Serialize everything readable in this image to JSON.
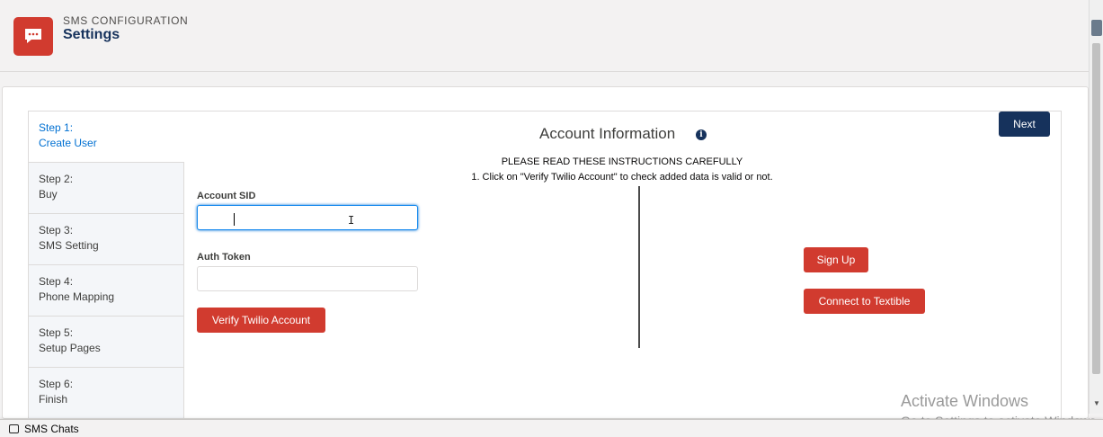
{
  "header": {
    "subtitle": "SMS CONFIGURATION",
    "title": "Settings",
    "icon": "chat-bubble-icon",
    "icon_color": "#d13b2f"
  },
  "steps": [
    {
      "step": "Step 1:",
      "label": "Create User",
      "active": true
    },
    {
      "step": "Step 2:",
      "label": "Buy",
      "active": false
    },
    {
      "step": "Step 3:",
      "label": "SMS Setting",
      "active": false
    },
    {
      "step": "Step 4:",
      "label": "Phone Mapping",
      "active": false
    },
    {
      "step": "Step 5:",
      "label": "Setup Pages",
      "active": false
    },
    {
      "step": "Step 6:",
      "label": "Finish",
      "active": false
    }
  ],
  "content": {
    "title": "Account Information",
    "instructions_heading": "PLEASE READ THESE INSTRUCTIONS CAREFULLY",
    "instruction_1": "1. Click on \"Verify Twilio Account\" to check added data is valid or not."
  },
  "buttons": {
    "next": "Next",
    "verify": "Verify Twilio Account",
    "sign_up": "Sign Up",
    "connect": "Connect to Textible"
  },
  "form": {
    "account_sid_label": "Account SID",
    "account_sid_value": "",
    "auth_token_label": "Auth Token",
    "auth_token_value": ""
  },
  "watermark": {
    "line1": "Activate Windows",
    "line2": "Go to Settings to activate Windows."
  },
  "utility_bar": {
    "item": "SMS Chats"
  },
  "colors": {
    "brand_red": "#d13b2f",
    "navy": "#16325c",
    "link_blue": "#0070d2"
  }
}
